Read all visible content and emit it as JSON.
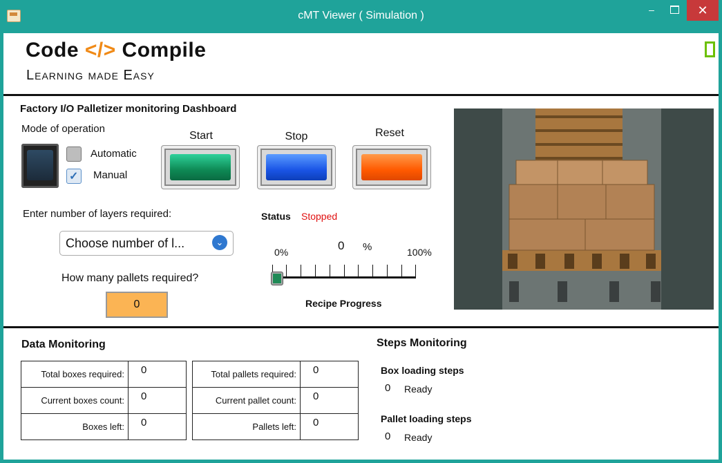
{
  "window": {
    "title": "cMT Viewer ( Simulation )",
    "minimize": "–",
    "close": "✕"
  },
  "header": {
    "logo_left": "Code ",
    "logo_brackets": "</>",
    "logo_right": " Compile",
    "tagline": "Learning made Easy"
  },
  "dashboard": {
    "title": "Factory I/O Palletizer monitoring Dashboard",
    "mode_label": "Mode of operation",
    "automatic_label": "Automatic",
    "automatic_checked": false,
    "manual_label": "Manual",
    "manual_checked": true,
    "check_glyph": "✓",
    "start_label": "Start",
    "stop_label": "Stop",
    "reset_label": "Reset",
    "layers_label": "Enter number of layers required:",
    "layers_value": "Choose number of l...",
    "chevron_glyph": "⌄",
    "pallets_label": "How many pallets required?",
    "pallets_value": "0",
    "status_label": "Status",
    "status_value": "Stopped",
    "progress_min": "0%",
    "progress_value": "0",
    "progress_unit": "%",
    "progress_max": "100%",
    "progress_fraction": 0,
    "recipe_label": "Recipe Progress"
  },
  "data_monitoring": {
    "title": "Data Monitoring",
    "boxes_rows": [
      {
        "label": "Total boxes required:",
        "value": "0"
      },
      {
        "label": "Current boxes count:",
        "value": "0"
      },
      {
        "label": "Boxes left:",
        "value": "0"
      }
    ],
    "pallets_rows": [
      {
        "label": "Total pallets required:",
        "value": "0"
      },
      {
        "label": "Current pallet count:",
        "value": "0"
      },
      {
        "label": "Pallets left:",
        "value": "0"
      }
    ]
  },
  "steps_monitoring": {
    "title": "Steps Monitoring",
    "box_title": "Box loading steps",
    "box_step": "0",
    "box_status": "Ready",
    "pallet_title": "Pallet loading steps",
    "pallet_step": "0",
    "pallet_status": "Ready"
  },
  "colors": {
    "window_frame": "#1fa39a",
    "close_button": "#c7393a",
    "logo_accent": "#f08a17",
    "status_stopped": "#e01010",
    "pallets_input_bg": "#fbb454",
    "start_button": "#0e8a55",
    "stop_button": "#1a55e6",
    "reset_button": "#ff5a00"
  }
}
